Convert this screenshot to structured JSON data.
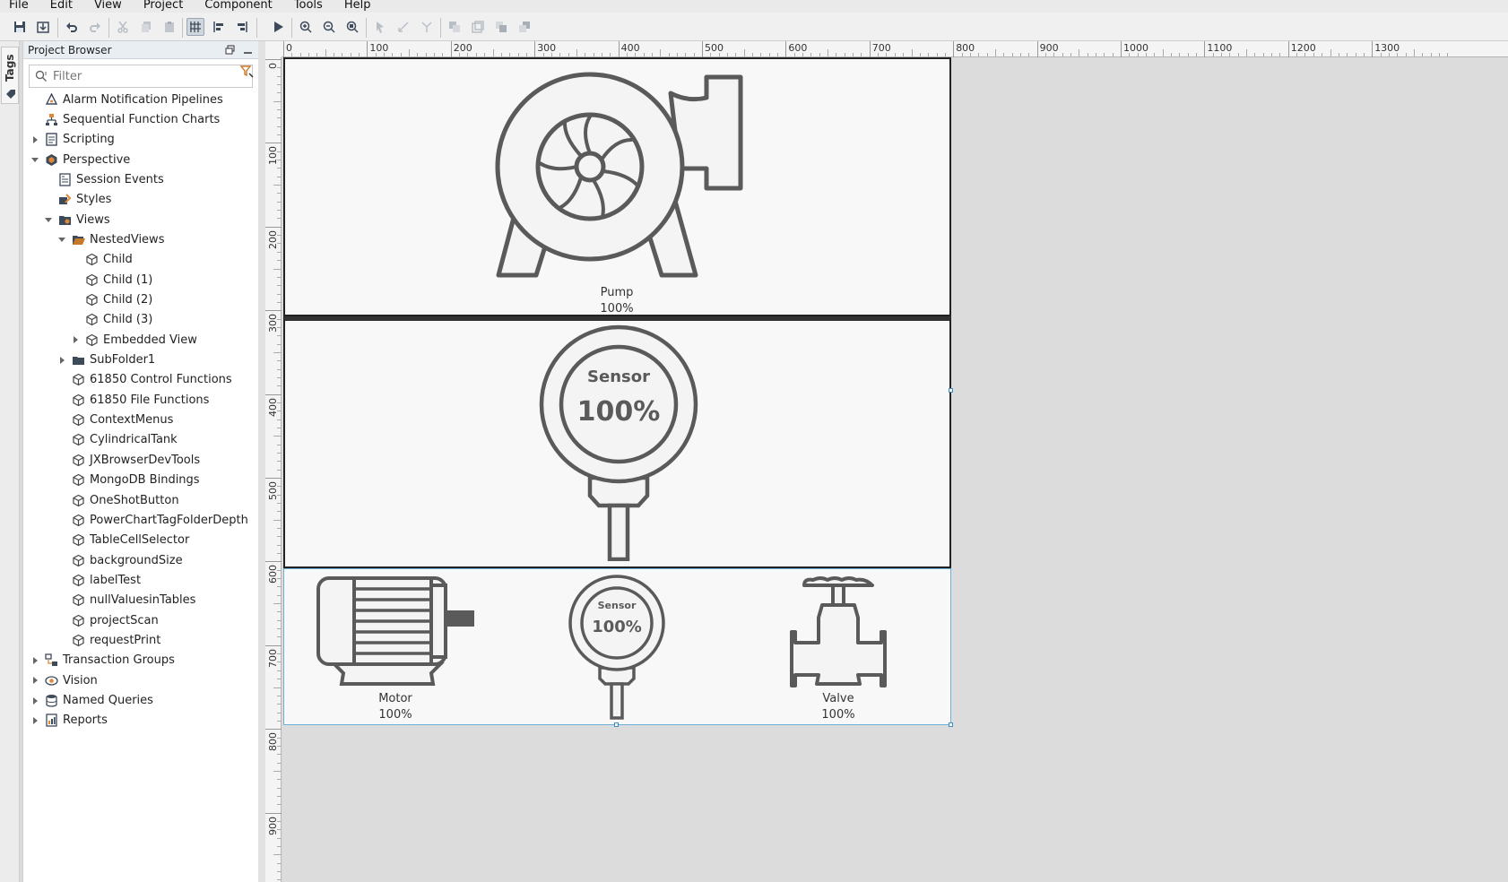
{
  "menu": [
    "File",
    "Edit",
    "View",
    "Project",
    "Component",
    "Tools",
    "Help"
  ],
  "tags_tab": "Tags",
  "project_browser": {
    "title": "Project Browser",
    "filter_placeholder": "Filter",
    "tree": [
      {
        "label": "Alarm Notification Pipelines",
        "icon": "pipeline-icon",
        "depth": 1,
        "expander": "none"
      },
      {
        "label": "Sequential Function Charts",
        "icon": "sfc-icon",
        "depth": 1,
        "expander": "none"
      },
      {
        "label": "Scripting",
        "icon": "script-icon",
        "depth": 1,
        "expander": "collapsed"
      },
      {
        "label": "Perspective",
        "icon": "perspective-icon",
        "depth": 1,
        "expander": "expanded"
      },
      {
        "label": "Session Events",
        "icon": "session-events-icon",
        "depth": 2,
        "expander": "none"
      },
      {
        "label": "Styles",
        "icon": "styles-icon",
        "depth": 2,
        "expander": "none"
      },
      {
        "label": "Views",
        "icon": "views-icon",
        "depth": 2,
        "expander": "expanded"
      },
      {
        "label": "NestedViews",
        "icon": "folder-open-icon",
        "depth": 3,
        "expander": "expanded"
      },
      {
        "label": "Child",
        "icon": "view-cube-icon",
        "depth": 4,
        "expander": "none"
      },
      {
        "label": "Child (1)",
        "icon": "view-cube-icon",
        "depth": 4,
        "expander": "none"
      },
      {
        "label": "Child (2)",
        "icon": "view-cube-icon",
        "depth": 4,
        "expander": "none"
      },
      {
        "label": "Child (3)",
        "icon": "view-cube-icon",
        "depth": 4,
        "expander": "none"
      },
      {
        "label": "Embedded View",
        "icon": "view-cube-icon",
        "depth": 4,
        "expander": "collapsed"
      },
      {
        "label": "SubFolder1",
        "icon": "folder-icon",
        "depth": 3,
        "expander": "collapsed"
      },
      {
        "label": "61850 Control Functions",
        "icon": "view-cube-icon",
        "depth": 3,
        "expander": "none"
      },
      {
        "label": "61850 File Functions",
        "icon": "view-cube-icon",
        "depth": 3,
        "expander": "none"
      },
      {
        "label": "ContextMenus",
        "icon": "view-cube-icon",
        "depth": 3,
        "expander": "none"
      },
      {
        "label": "CylindricalTank",
        "icon": "view-cube-icon",
        "depth": 3,
        "expander": "none"
      },
      {
        "label": "JXBrowserDevTools",
        "icon": "view-cube-icon",
        "depth": 3,
        "expander": "none"
      },
      {
        "label": "MongoDB Bindings",
        "icon": "view-cube-icon",
        "depth": 3,
        "expander": "none"
      },
      {
        "label": "OneShotButton",
        "icon": "view-cube-icon",
        "depth": 3,
        "expander": "none"
      },
      {
        "label": "PowerChartTagFolderDepth",
        "icon": "view-cube-icon",
        "depth": 3,
        "expander": "none"
      },
      {
        "label": "TableCellSelector",
        "icon": "view-cube-icon",
        "depth": 3,
        "expander": "none"
      },
      {
        "label": "backgroundSize",
        "icon": "view-cube-icon",
        "depth": 3,
        "expander": "none"
      },
      {
        "label": "labelTest",
        "icon": "view-cube-icon",
        "depth": 3,
        "expander": "none"
      },
      {
        "label": "nullValuesinTables",
        "icon": "view-cube-icon",
        "depth": 3,
        "expander": "none"
      },
      {
        "label": "projectScan",
        "icon": "view-cube-icon",
        "depth": 3,
        "expander": "none"
      },
      {
        "label": "requestPrint",
        "icon": "view-cube-icon",
        "depth": 3,
        "expander": "none"
      },
      {
        "label": "Transaction Groups",
        "icon": "transaction-icon",
        "depth": 1,
        "expander": "collapsed"
      },
      {
        "label": "Vision",
        "icon": "vision-icon",
        "depth": 1,
        "expander": "collapsed"
      },
      {
        "label": "Named Queries",
        "icon": "queries-icon",
        "depth": 1,
        "expander": "collapsed"
      },
      {
        "label": "Reports",
        "icon": "reports-icon",
        "depth": 1,
        "expander": "collapsed"
      }
    ]
  },
  "ruler": {
    "top_labels": [
      "0",
      "100",
      "200",
      "300",
      "400",
      "500",
      "600",
      "700",
      "800",
      "900",
      "1000",
      "1100",
      "1200",
      "1300"
    ],
    "left_labels": [
      "0",
      "100",
      "200",
      "300",
      "400",
      "500",
      "600",
      "700",
      "800",
      "900"
    ]
  },
  "view": {
    "pump": {
      "name": "Pump",
      "value": "100%"
    },
    "sensor_large": {
      "title": "Sensor",
      "value": "100%"
    },
    "motor": {
      "name": "Motor",
      "value": "100%"
    },
    "sensor_small": {
      "title": "Sensor",
      "value": "100%"
    },
    "valve": {
      "name": "Valve",
      "value": "100%"
    }
  },
  "colors": {
    "symbol_stroke": "#5a5a5a",
    "symbol_fill": "#f4f4f4",
    "selection": "#3a8fc8"
  }
}
